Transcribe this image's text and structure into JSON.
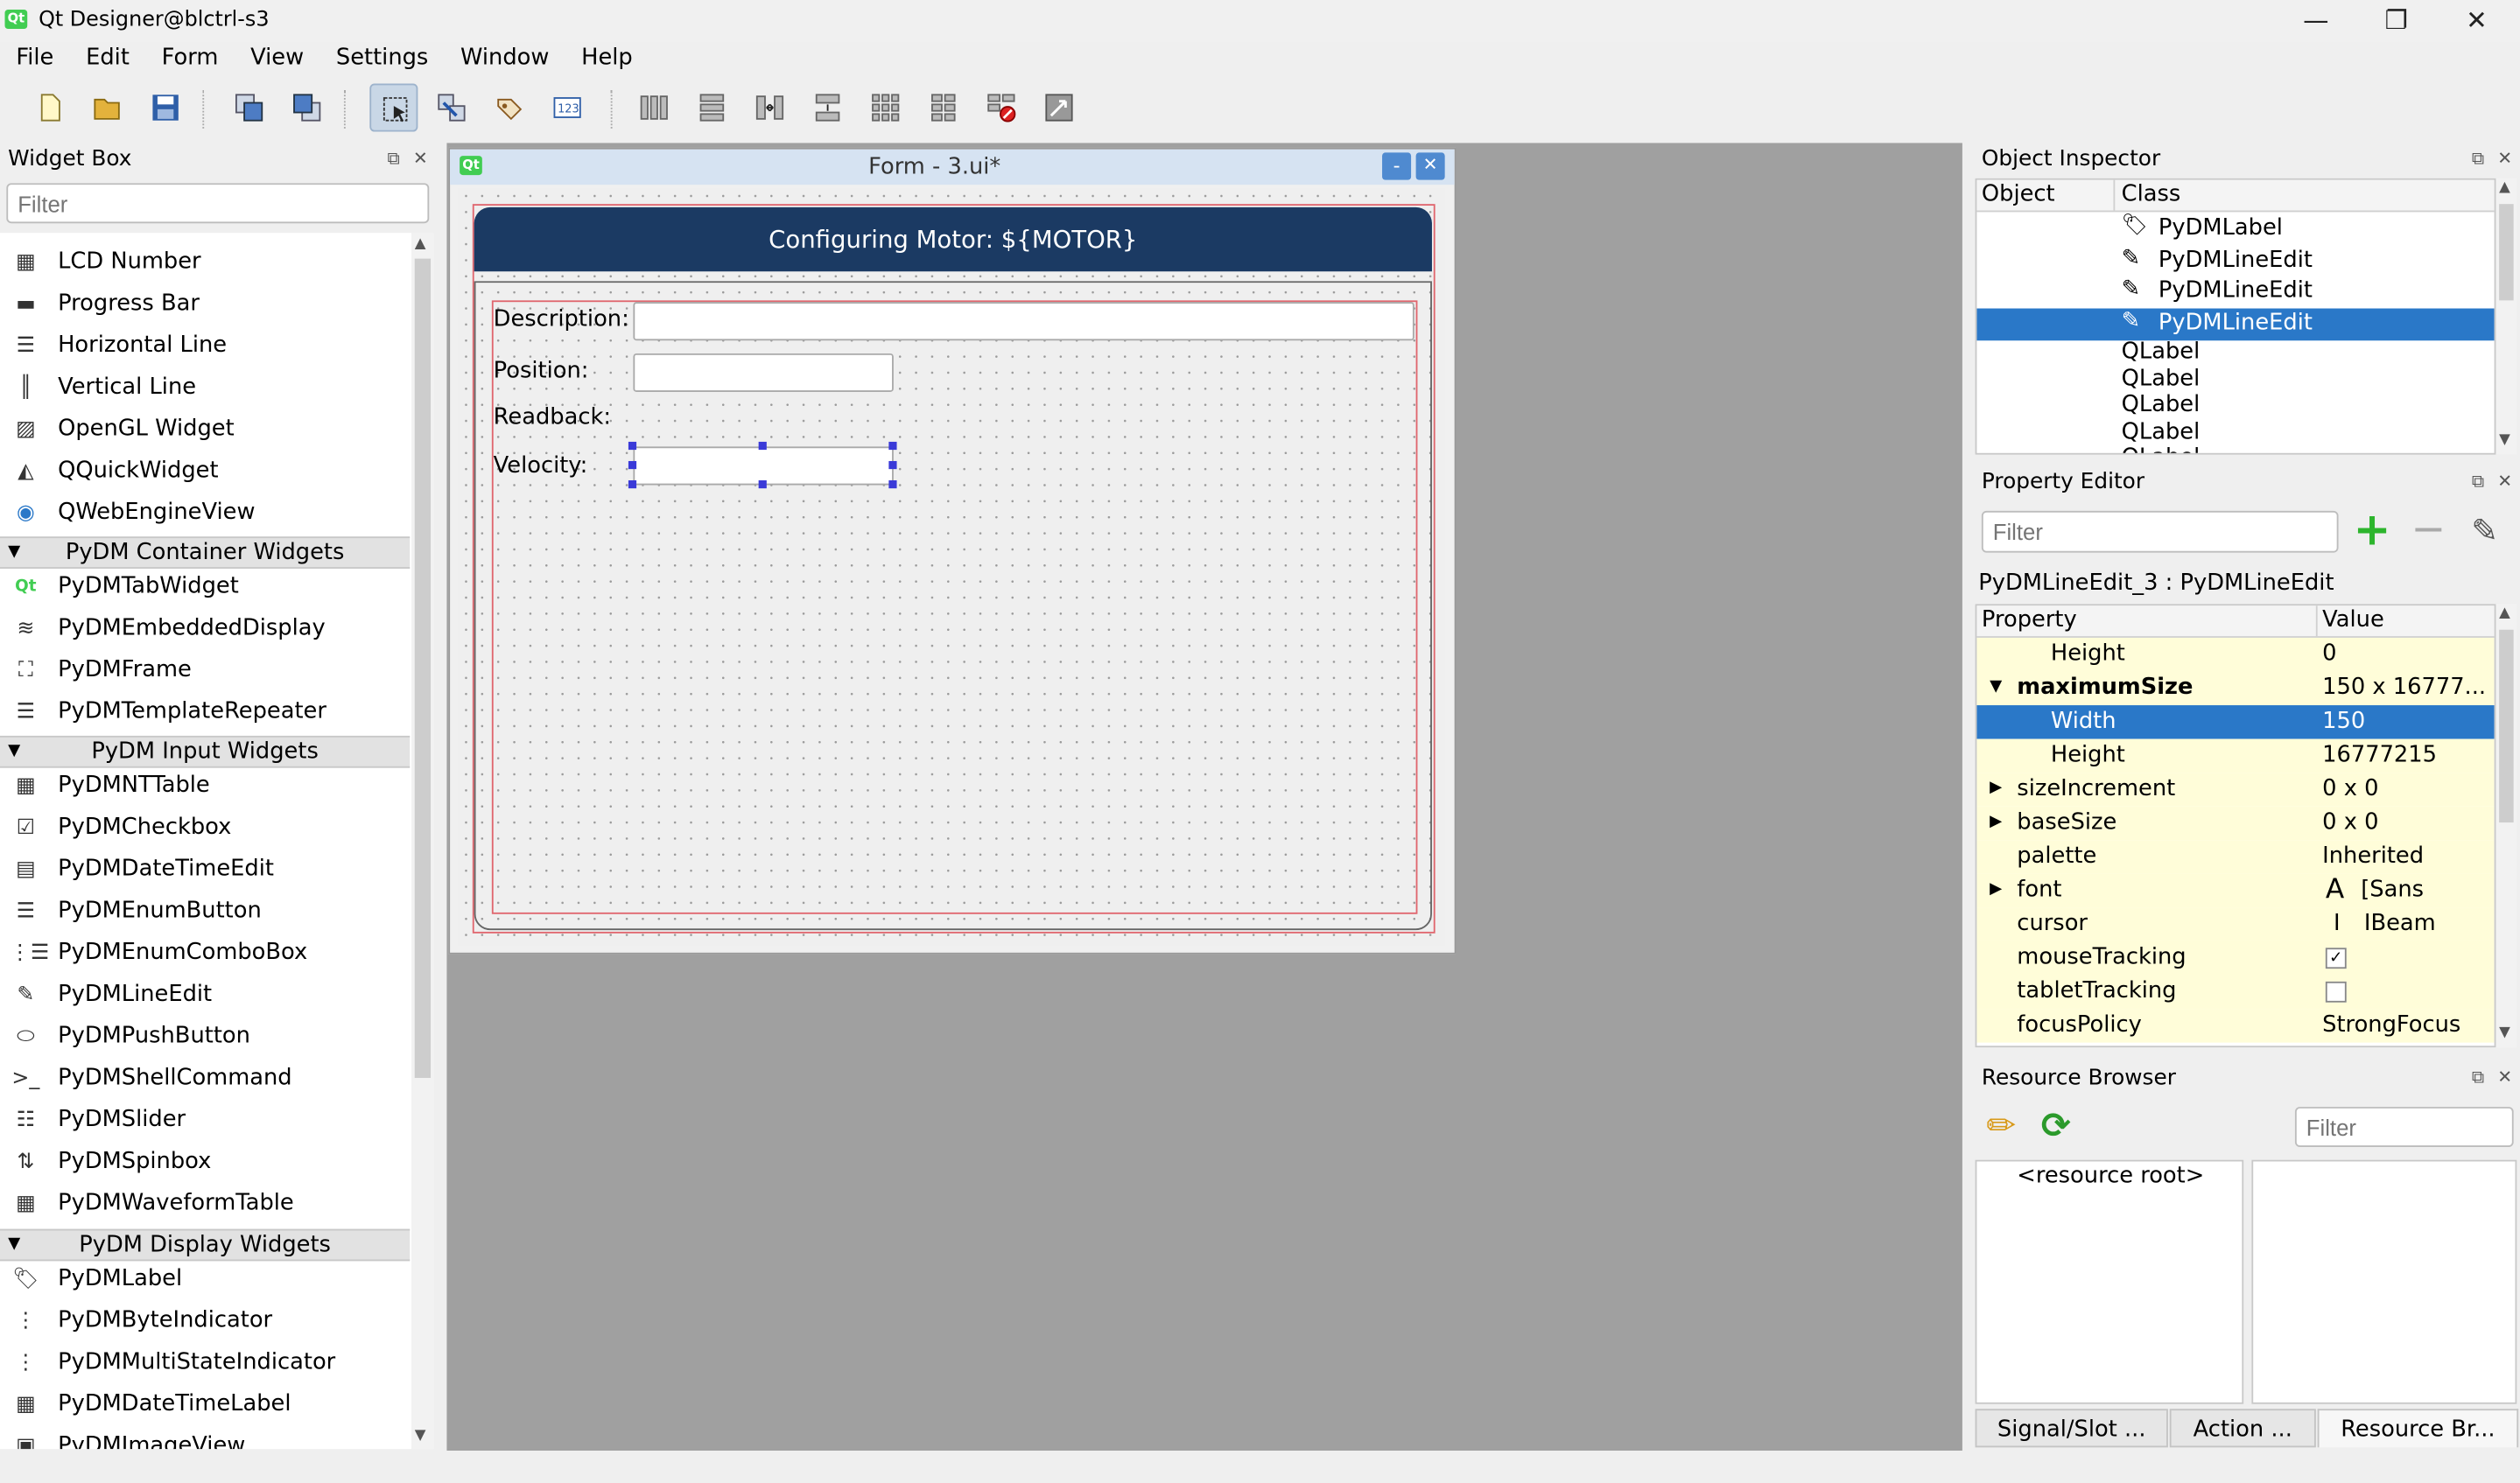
{
  "window": {
    "title": "Qt Designer@blctrl-s3",
    "logo_text": "Qt",
    "minimize": "—",
    "maximize": "❐",
    "close": "✕"
  },
  "menu": [
    "File",
    "Edit",
    "Form",
    "View",
    "Settings",
    "Window",
    "Help"
  ],
  "widget_box": {
    "title": "Widget Box",
    "filter_placeholder": "Filter",
    "top_items": [
      "LCD Number",
      "Progress Bar",
      "Horizontal Line",
      "Vertical Line",
      "OpenGL Widget",
      "QQuickWidget",
      "QWebEngineView"
    ],
    "categories": [
      {
        "name": "PyDM Container Widgets",
        "items": [
          "PyDMTabWidget",
          "PyDMEmbeddedDisplay",
          "PyDMFrame",
          "PyDMTemplateRepeater"
        ]
      },
      {
        "name": "PyDM Input Widgets",
        "items": [
          "PyDMNTTable",
          "PyDMCheckbox",
          "PyDMDateTimeEdit",
          "PyDMEnumButton",
          "PyDMEnumComboBox",
          "PyDMLineEdit",
          "PyDMPushButton",
          "PyDMShellCommand",
          "PyDMSlider",
          "PyDMSpinbox",
          "PyDMWaveformTable"
        ]
      },
      {
        "name": "PyDM Display Widgets",
        "items": [
          "PyDMLabel",
          "PyDMByteIndicator",
          "PyDMMultiStateIndicator",
          "PyDMDateTimeLabel",
          "PyDMImageView"
        ]
      }
    ]
  },
  "form": {
    "title": "Form - 3.ui*",
    "header": "Configuring Motor: ${MOTOR}",
    "labels": {
      "description": "Description:",
      "position": "Position:",
      "readback": "Readback:",
      "velocity": "Velocity:"
    },
    "btn_min": "-",
    "btn_close": "✕"
  },
  "object_inspector": {
    "title": "Object Inspector",
    "columns": [
      "Object",
      "Class"
    ],
    "rows": [
      "PyDMLabel",
      "PyDMLineEdit",
      "PyDMLineEdit",
      "PyDMLineEdit",
      "QLabel",
      "QLabel",
      "QLabel",
      "QLabel",
      "QLabel"
    ]
  },
  "property_editor": {
    "title": "Property Editor",
    "filter_placeholder": "Filter",
    "object_label": "PyDMLineEdit_3 : PyDMLineEdit",
    "columns": [
      "Property",
      "Value"
    ],
    "rows": [
      {
        "name": "Height",
        "value": "0"
      },
      {
        "name": "maximumSize",
        "value": "150 x 16777..."
      },
      {
        "name": "Width",
        "value": "150"
      },
      {
        "name": "Height",
        "value": "16777215"
      },
      {
        "name": "sizeIncrement",
        "value": "0 x 0"
      },
      {
        "name": "baseSize",
        "value": "0 x 0"
      },
      {
        "name": "palette",
        "value": "Inherited"
      },
      {
        "name": "font",
        "value": "[Sans Seri..."
      },
      {
        "name": "cursor",
        "value": "IBeam"
      },
      {
        "name": "mouseTracking",
        "value": ""
      },
      {
        "name": "tabletTracking",
        "value": ""
      },
      {
        "name": "focusPolicy",
        "value": "StrongFocus"
      }
    ],
    "font_glyph": "A",
    "cursor_glyph": "I",
    "check_mark": "✓"
  },
  "resource_browser": {
    "title": "Resource Browser",
    "filter_placeholder": "Filter",
    "root": "<resource root>"
  },
  "bottom_tabs": [
    "Signal/Slot ...",
    "Action ...",
    "Resource Br..."
  ],
  "colors": {
    "selection": "#2a78c8",
    "form_header": "#1b3a63",
    "highlight_yellow": "#fffdd9",
    "red_layout": "#e0666e"
  }
}
